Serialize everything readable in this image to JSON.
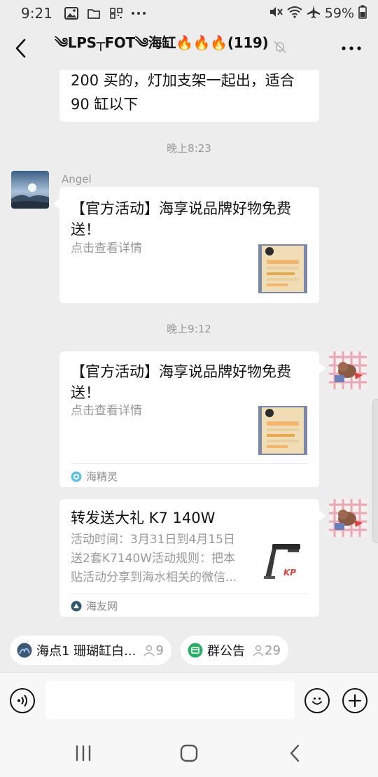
{
  "status_bar": {
    "time": "9:21",
    "battery": "59%",
    "left_icons": [
      "image-icon",
      "folder-icon",
      "qr-icon",
      "more-dots-icon"
    ],
    "right_icons": [
      "mute-icon",
      "wifi-icon",
      "airplane-icon",
      "battery-icon"
    ]
  },
  "header": {
    "title": "༄LPS┬FOT༄海缸🔥🔥🔥(119)",
    "back_icon": "chevron-left-icon",
    "mute_icon": "bell-off-icon",
    "more_icon": "more-horizontal-icon"
  },
  "messages": {
    "partial": {
      "line1": "200 买的，灯加支架一起出，适合",
      "line2": "90 缸以下"
    },
    "time1": "晚上8:23",
    "angel": {
      "name": "Angel",
      "title_line1": "【官方活动】海享说品牌好物免费",
      "title_line2": "送！",
      "desc": "点击查看详情"
    },
    "time2": "晚上9:12",
    "self1": {
      "title_line1": "【官方活动】海享说品牌好物免费",
      "title_line2": "送！",
      "desc": "点击查看详情",
      "source": "海精灵"
    },
    "self2": {
      "title": "转发送大礼 K7 140W",
      "desc_line1": "活动时间：3月31日到4月15日",
      "desc_line2": "送2套K7140W活动规则：把本",
      "desc_line3": "贴活动分享到海水相关的微信...",
      "source": "海友网",
      "thumb_text": "KP"
    }
  },
  "chips": [
    {
      "label": "海点1 珊瑚缸白...",
      "count": "9"
    },
    {
      "label": "群公告",
      "count": "29"
    }
  ],
  "input": {
    "placeholder": "",
    "voice_icon": "voice-icon",
    "emoji_icon": "emoji-icon",
    "plus_icon": "plus-icon"
  },
  "colors": {
    "background": "#ededed",
    "bubble": "#ffffff",
    "secondary_text": "#999999",
    "chip_icon_green": "#2bae66"
  }
}
